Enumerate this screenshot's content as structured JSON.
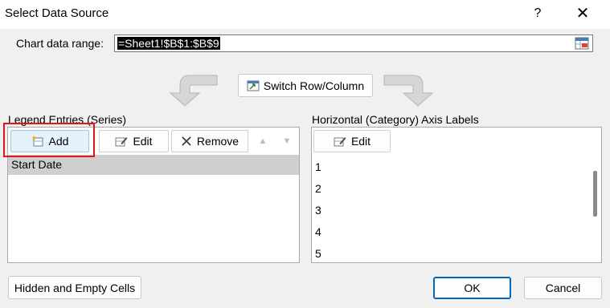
{
  "dialog": {
    "title": "Select Data Source",
    "help_label": "?",
    "close_label": "✕"
  },
  "chart_range": {
    "label": "Chart data range:",
    "value": "=Sheet1!$B$1:$B$9"
  },
  "switch": {
    "label": "Switch Row/Column"
  },
  "legend": {
    "label": "Legend Entries (Series)",
    "add_label": "Add",
    "edit_label": "Edit",
    "remove_label": "Remove",
    "up_label": "▲",
    "down_label": "▼",
    "series": [
      "Start Date"
    ]
  },
  "axis": {
    "label": "Horizontal (Category) Axis Labels",
    "edit_label": "Edit",
    "items": [
      "1",
      "2",
      "3",
      "4",
      "5"
    ]
  },
  "footer": {
    "hidden_empty_label": "Hidden and Empty Cells",
    "ok_label": "OK",
    "cancel_label": "Cancel"
  },
  "colors": {
    "highlight": "#e0161e",
    "selection": "#cfcfcf",
    "default_button_border": "#0067c0"
  },
  "icons": [
    "help-icon",
    "close-icon",
    "range-picker-icon",
    "switch-row-column-icon",
    "add-series-icon",
    "edit-icon",
    "remove-icon",
    "move-up-icon",
    "move-down-icon"
  ]
}
